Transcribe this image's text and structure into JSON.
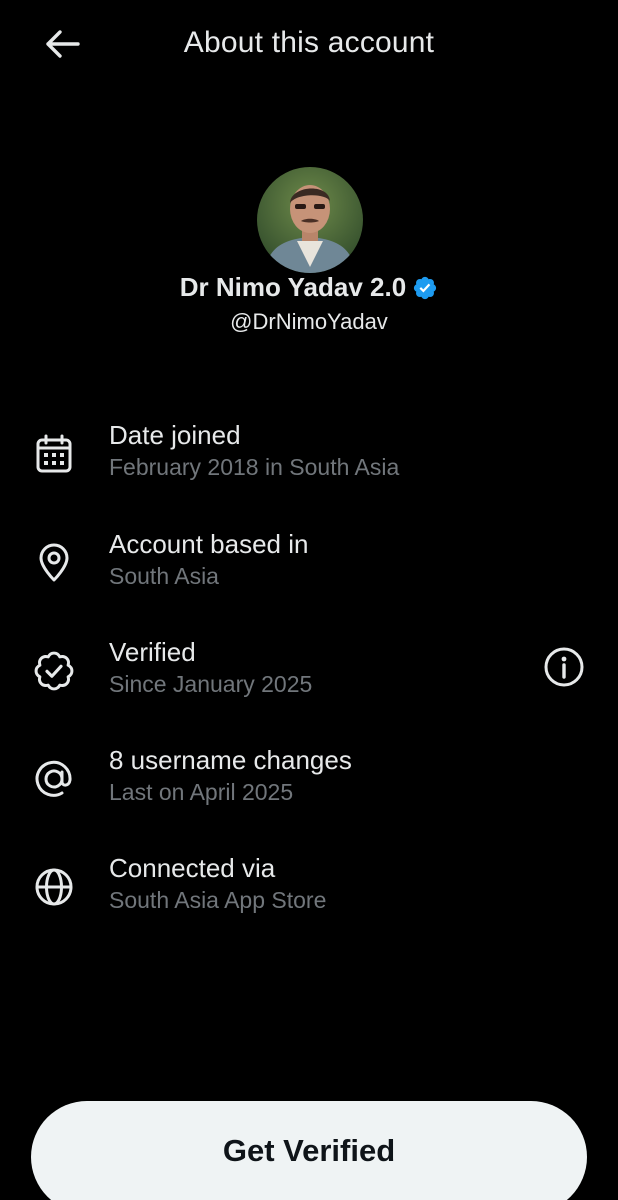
{
  "header": {
    "title": "About this account",
    "back_icon": "arrow-left-icon"
  },
  "profile": {
    "display_name": "Dr Nimo Yadav 2.0",
    "handle": "@DrNimoYadav",
    "verified_badge_color": "#1d9bf0"
  },
  "details": [
    {
      "icon": "calendar-icon",
      "label": "Date joined",
      "value": "February 2018 in South Asia"
    },
    {
      "icon": "location-pin-icon",
      "label": "Account based in",
      "value": "South Asia"
    },
    {
      "icon": "verified-badge-icon",
      "label": "Verified",
      "value": "Since January 2025",
      "action_icon": "info-icon"
    },
    {
      "icon": "at-sign-icon",
      "label": "8 username changes",
      "value": "Last on April 2025"
    },
    {
      "icon": "globe-icon",
      "label": "Connected via",
      "value": "South Asia App Store"
    }
  ],
  "cta": {
    "label": "Get Verified"
  },
  "colors": {
    "background": "#000000",
    "primary_text": "#e7e9ea",
    "secondary_text": "#71767b",
    "button_bg": "#eff3f4",
    "button_text": "#0f1419"
  }
}
